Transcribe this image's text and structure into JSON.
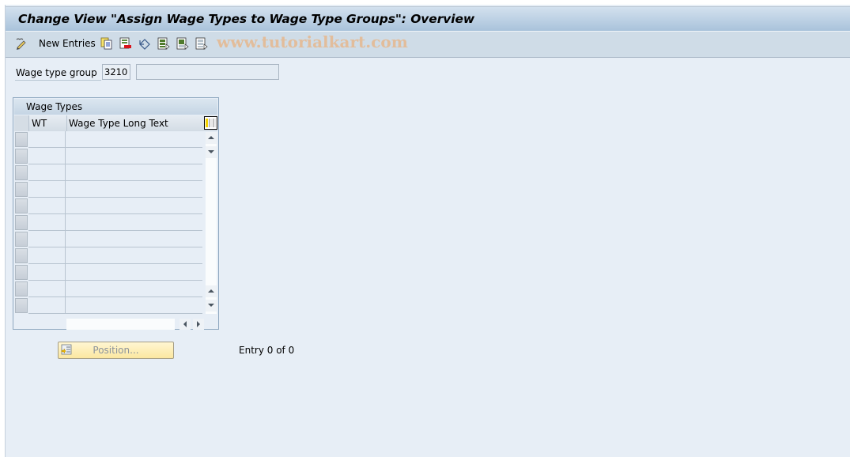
{
  "window": {
    "title": "Change View \"Assign Wage Types to Wage Type Groups\": Overview"
  },
  "toolbar": {
    "items": [
      {
        "name": "display-change",
        "icon": "pencil-glasses-icon"
      },
      {
        "name": "new-entries",
        "label": "New Entries"
      },
      {
        "name": "copy-as",
        "icon": "copy-icon"
      },
      {
        "name": "delete",
        "icon": "delete-icon"
      },
      {
        "name": "undo-change",
        "icon": "undo-icon"
      },
      {
        "name": "select-all",
        "icon": "select-all-icon"
      },
      {
        "name": "select-block",
        "icon": "select-block-icon"
      },
      {
        "name": "deselect-all",
        "icon": "deselect-all-icon"
      }
    ],
    "new_entries_label": "New Entries",
    "watermark": "www.tutorialkart.com"
  },
  "header_fields": {
    "wage_type_group_label": "Wage type group",
    "wage_type_group_value": "3210",
    "wage_type_group_description": ""
  },
  "table": {
    "caption": "Wage Types",
    "columns": [
      "WT",
      "Wage Type Long Text"
    ],
    "rows": [
      {
        "wt": "",
        "text": ""
      },
      {
        "wt": "",
        "text": ""
      },
      {
        "wt": "",
        "text": ""
      },
      {
        "wt": "",
        "text": ""
      },
      {
        "wt": "",
        "text": ""
      },
      {
        "wt": "",
        "text": ""
      },
      {
        "wt": "",
        "text": ""
      },
      {
        "wt": "",
        "text": ""
      },
      {
        "wt": "",
        "text": ""
      },
      {
        "wt": "",
        "text": ""
      },
      {
        "wt": "",
        "text": ""
      }
    ]
  },
  "footer": {
    "position_button_label": "Position...",
    "entry_text": "Entry 0 of 0"
  },
  "colors": {
    "background": "#e7eef6",
    "title_bar": "#a9c3db",
    "toolbar": "#cfdce7",
    "position_button": "#fbe7a0",
    "watermark": "#e6b88e"
  }
}
